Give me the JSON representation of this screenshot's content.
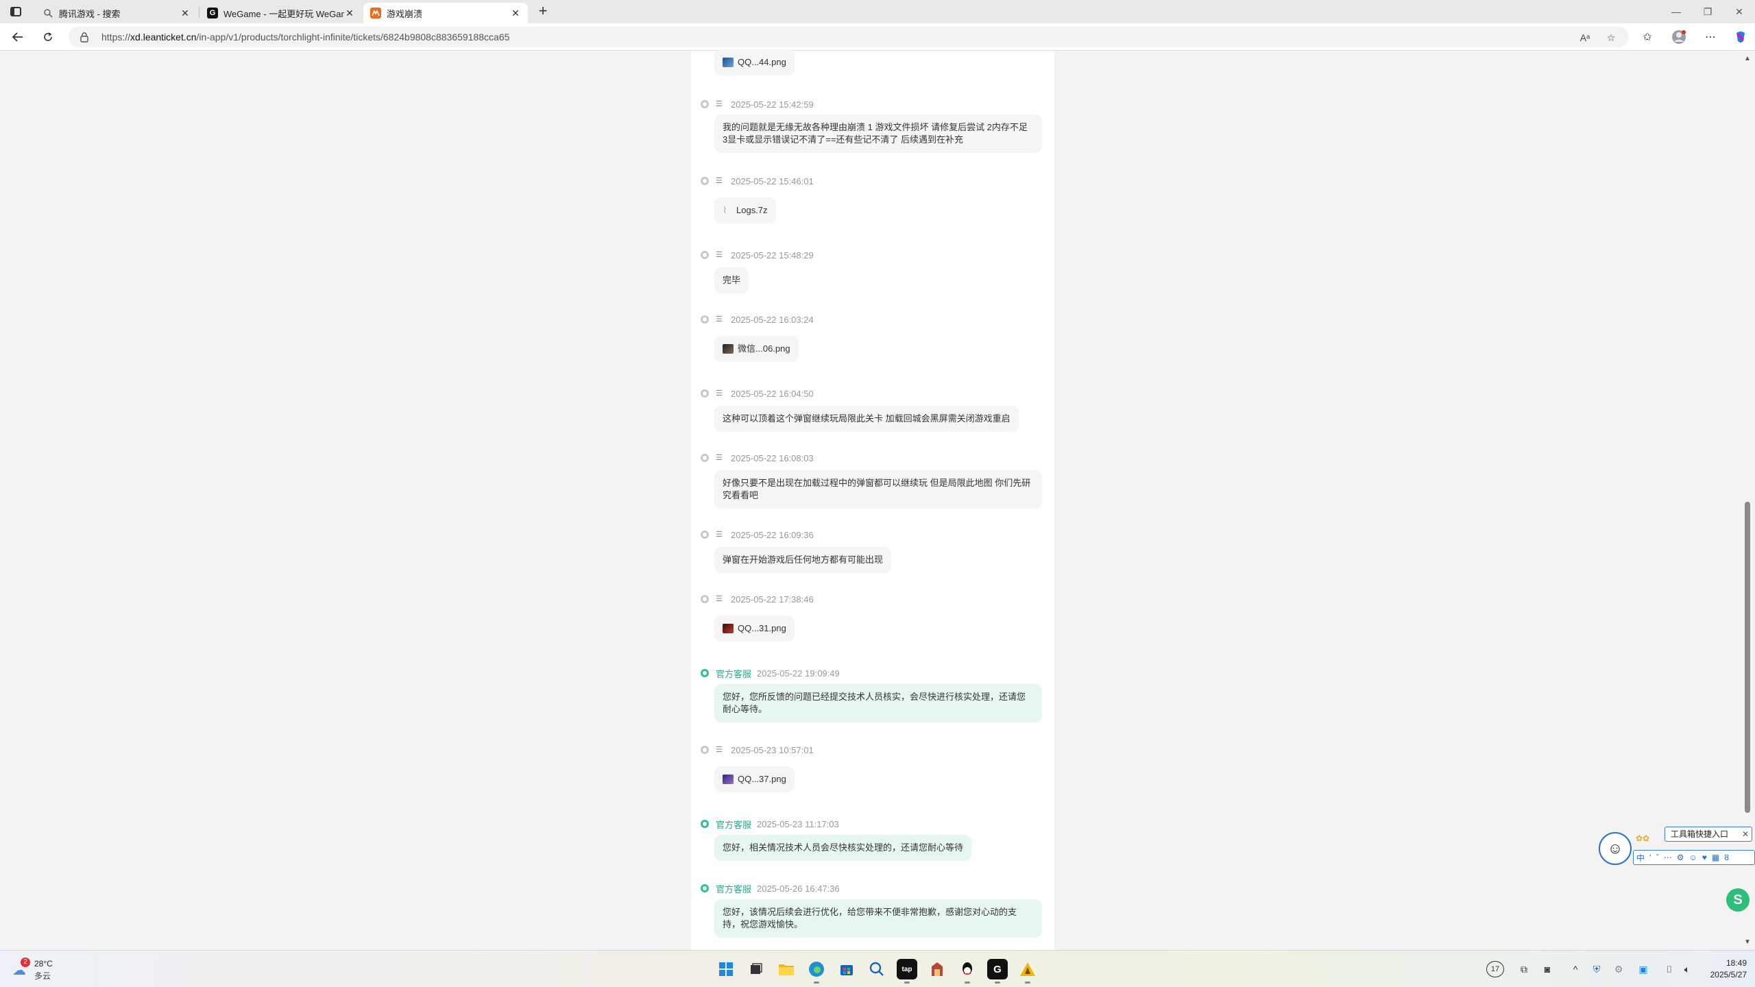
{
  "browser": {
    "tabs": [
      {
        "title": "腾讯游戏 - 搜索",
        "icon": "search-icon"
      },
      {
        "title": "WeGame - 一起更好玩 WeGame",
        "icon": "wegame-icon"
      },
      {
        "title": "游戏崩溃",
        "icon": "leanticket-icon",
        "active": true
      }
    ],
    "url_prefix": "https://",
    "url_host": "xd.leanticket.cn",
    "url_path": "/in-app/v1/products/torchlight-infinite/tickets/6824b9808c883659188cca65"
  },
  "thread": {
    "top_file": {
      "name": "QQ...44.png"
    },
    "messages": [
      {
        "time": "2025-05-22 15:42:59",
        "text": "我的问题就是无缘无故各种理由崩溃 1 游戏文件损坏 请修复后尝试 2内存不足 3显卡或显示错误记不清了==还有些记不清了 后续遇到在补充"
      },
      {
        "time": "2025-05-22 15:46:01",
        "file": "Logs.7z"
      },
      {
        "time": "2025-05-22 15:48:29",
        "text": "完毕"
      },
      {
        "time": "2025-05-22 16:03:24",
        "file": "微信...06.png"
      },
      {
        "time": "2025-05-22 16:04:50",
        "text": "这种可以顶着这个弹窗继续玩局限此关卡 加载回城会黑屏需关闭游戏重启"
      },
      {
        "time": "2025-05-22 16:08:03",
        "text": "好像只要不是出现在加载过程中的弹窗都可以继续玩 但是局限此地图 你们先研究看看吧"
      },
      {
        "time": "2025-05-22 16:09:36",
        "text": "弹窗在开始游戏后任何地方都有可能出现"
      },
      {
        "time": "2025-05-22 17:38:46",
        "file": "QQ...31.png"
      },
      {
        "staff": "官方客服",
        "time": "2025-05-22 19:09:49",
        "text": "您好，您所反馈的问题已经提交技术人员核实，会尽快进行核实处理，还请您耐心等待。"
      },
      {
        "time": "2025-05-23 10:57:01",
        "file": "QQ...37.png"
      },
      {
        "staff": "官方客服",
        "time": "2025-05-23 11:17:03",
        "text": "您好，相关情况技术人员会尽快核实处理的，还请您耐心等待"
      },
      {
        "staff": "官方客服",
        "time": "2025-05-26 16:47:36",
        "text": "您好，该情况后续会进行优化，给您带来不便非常抱歉，感谢您对心动的支持，祝您游戏愉快。"
      }
    ]
  },
  "floating_tool": {
    "tip": "工具箱快捷入口",
    "bar_items": [
      "中",
      "ʻ",
      "ˇ",
      "⋯",
      "⚙",
      "☺",
      "♥",
      "▦",
      "8"
    ]
  },
  "taskbar": {
    "weather_badge": "2",
    "temperature": "28°C",
    "condition": "多云",
    "clock_time": "18:49",
    "clock_date": "2025/5/27",
    "tray_count": "17"
  },
  "colors": {
    "staff_accent": "#1fb08a",
    "staff_bubble": "#e6f7f2",
    "user_bubble": "#f5f5f5"
  }
}
